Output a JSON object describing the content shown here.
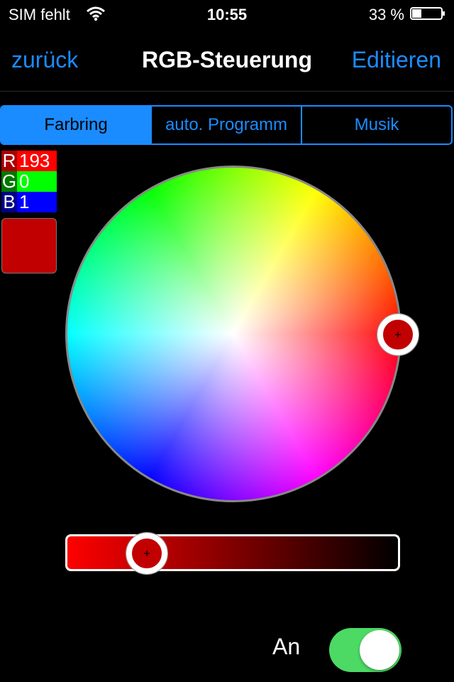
{
  "status_bar": {
    "carrier": "SIM fehlt",
    "time": "10:55",
    "battery_percent": "33 %",
    "battery_level": 0.33
  },
  "nav": {
    "back_label": "zurück",
    "title": "RGB-Steuerung",
    "edit_label": "Editieren"
  },
  "tabs": [
    {
      "label": "Farbring",
      "active": true
    },
    {
      "label": "auto. Programm",
      "active": false
    },
    {
      "label": "Musik",
      "active": false
    }
  ],
  "rgb": {
    "r_label": "R",
    "r_value": "193",
    "g_label": "G",
    "g_value": "0",
    "b_label": "B",
    "b_value": "1"
  },
  "current_color": "#c10001",
  "toggle": {
    "label": "An",
    "on": true
  },
  "colors": {
    "accent": "#1a8cff",
    "toggle_on": "#4cd964"
  }
}
